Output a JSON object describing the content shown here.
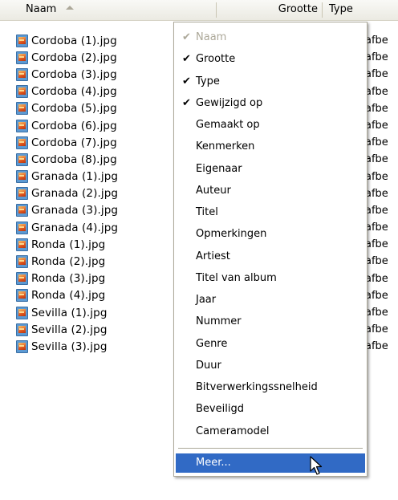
{
  "header": {
    "name_label": "Naam",
    "size_label": "Grootte",
    "type_label": "Type"
  },
  "files": [
    {
      "name": "Cordoba (1).jpg",
      "type": "afbe"
    },
    {
      "name": "Cordoba (2).jpg",
      "type": "afbe"
    },
    {
      "name": "Cordoba (3).jpg",
      "type": "afbe"
    },
    {
      "name": "Cordoba (4).jpg",
      "type": "afbe"
    },
    {
      "name": "Cordoba (5).jpg",
      "type": "afbe"
    },
    {
      "name": "Cordoba (6).jpg",
      "type": "afbe"
    },
    {
      "name": "Cordoba (7).jpg",
      "type": "afbe"
    },
    {
      "name": "Cordoba (8).jpg",
      "type": "afbe"
    },
    {
      "name": "Granada (1).jpg",
      "type": "afbe"
    },
    {
      "name": "Granada (2).jpg",
      "type": "afbe"
    },
    {
      "name": "Granada (3).jpg",
      "type": "afbe"
    },
    {
      "name": "Granada (4).jpg",
      "type": "afbe"
    },
    {
      "name": "Ronda (1).jpg",
      "type": "afbe"
    },
    {
      "name": "Ronda (2).jpg",
      "type": "afbe"
    },
    {
      "name": "Ronda (3).jpg",
      "type": "afbe"
    },
    {
      "name": "Ronda (4).jpg",
      "type": "afbe"
    },
    {
      "name": "Sevilla (1).jpg",
      "type": "afbe"
    },
    {
      "name": "Sevilla (2).jpg",
      "type": "afbe"
    },
    {
      "name": "Sevilla (3).jpg",
      "type": "afbe"
    }
  ],
  "file_icon": "jpeg-image-icon",
  "context_menu": {
    "items": [
      {
        "label": "Naam",
        "checked": true,
        "disabled": true
      },
      {
        "label": "Grootte",
        "checked": true,
        "disabled": false
      },
      {
        "label": "Type",
        "checked": true,
        "disabled": false
      },
      {
        "label": "Gewijzigd op",
        "checked": true,
        "disabled": false
      },
      {
        "label": "Gemaakt op",
        "checked": false,
        "disabled": false
      },
      {
        "label": "Kenmerken",
        "checked": false,
        "disabled": false
      },
      {
        "label": "Eigenaar",
        "checked": false,
        "disabled": false
      },
      {
        "label": "Auteur",
        "checked": false,
        "disabled": false
      },
      {
        "label": "Titel",
        "checked": false,
        "disabled": false
      },
      {
        "label": "Opmerkingen",
        "checked": false,
        "disabled": false
      },
      {
        "label": "Artiest",
        "checked": false,
        "disabled": false
      },
      {
        "label": "Titel van album",
        "checked": false,
        "disabled": false
      },
      {
        "label": "Jaar",
        "checked": false,
        "disabled": false
      },
      {
        "label": "Nummer",
        "checked": false,
        "disabled": false
      },
      {
        "label": "Genre",
        "checked": false,
        "disabled": false
      },
      {
        "label": "Duur",
        "checked": false,
        "disabled": false
      },
      {
        "label": "Bitverwerkingssnelheid",
        "checked": false,
        "disabled": false
      },
      {
        "label": "Beveiligd",
        "checked": false,
        "disabled": false
      },
      {
        "label": "Cameramodel",
        "checked": false,
        "disabled": false
      }
    ],
    "more_label": "Meer...",
    "check_glyph": "✔"
  },
  "colors": {
    "highlight": "#316ac5",
    "disabled_text": "#aca899",
    "header_bg": "#ebeae2"
  }
}
